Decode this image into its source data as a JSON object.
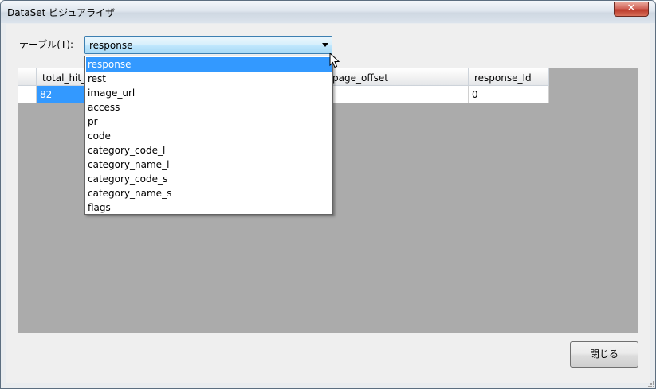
{
  "window": {
    "title": "DataSet ビジュアライザ",
    "close_glyph": "✕"
  },
  "table_selector": {
    "label": "テーブル(T):",
    "selected": "response",
    "options": [
      "response",
      "rest",
      "image_url",
      "access",
      "pr",
      "code",
      "category_code_l",
      "category_name_l",
      "category_code_s",
      "category_name_s",
      "flags"
    ]
  },
  "grid": {
    "columns": [
      "total_hit_",
      "page_offset",
      "response_Id"
    ],
    "rows": [
      [
        "82",
        "",
        "0"
      ]
    ]
  },
  "footer": {
    "close_label": "閉じる"
  },
  "colors": {
    "selection": "#3399ff",
    "grid_background": "#ababab"
  }
}
